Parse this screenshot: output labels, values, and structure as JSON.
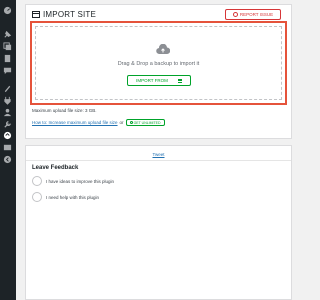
{
  "sidebar": {
    "icons": [
      "dashboard-icon",
      "pin-icon",
      "media-icon",
      "pages-icon",
      "comments-icon",
      "appearance-icon",
      "plugins-icon",
      "users-icon",
      "tools-icon",
      "backup-plugin-icon",
      "settings-icon",
      "collapse-icon"
    ]
  },
  "import_card": {
    "title": "IMPORT SITE",
    "report_label": "REPORT ISSUE",
    "dropzone_text": "Drag & Drop a backup to import it",
    "import_from_label": "IMPORT FROM",
    "max_upload_text": "Maximum upload file size: 3 GB.",
    "increase_link": "How to: Increase maximum upload file size",
    "or_text": "or",
    "unlimited_label": "GET UNLIMITED"
  },
  "feedback_card": {
    "tweet_label": "Tweet",
    "title": "Leave Feedback",
    "options": [
      "I have ideas to improve this plugin",
      "I need help with this plugin"
    ]
  },
  "colors": {
    "accent_red": "#d63638",
    "accent_green": "#00a32a",
    "dropzone_border": "#e5533b",
    "sidebar_bg": "#1d2327",
    "link_blue": "#2271b1"
  }
}
